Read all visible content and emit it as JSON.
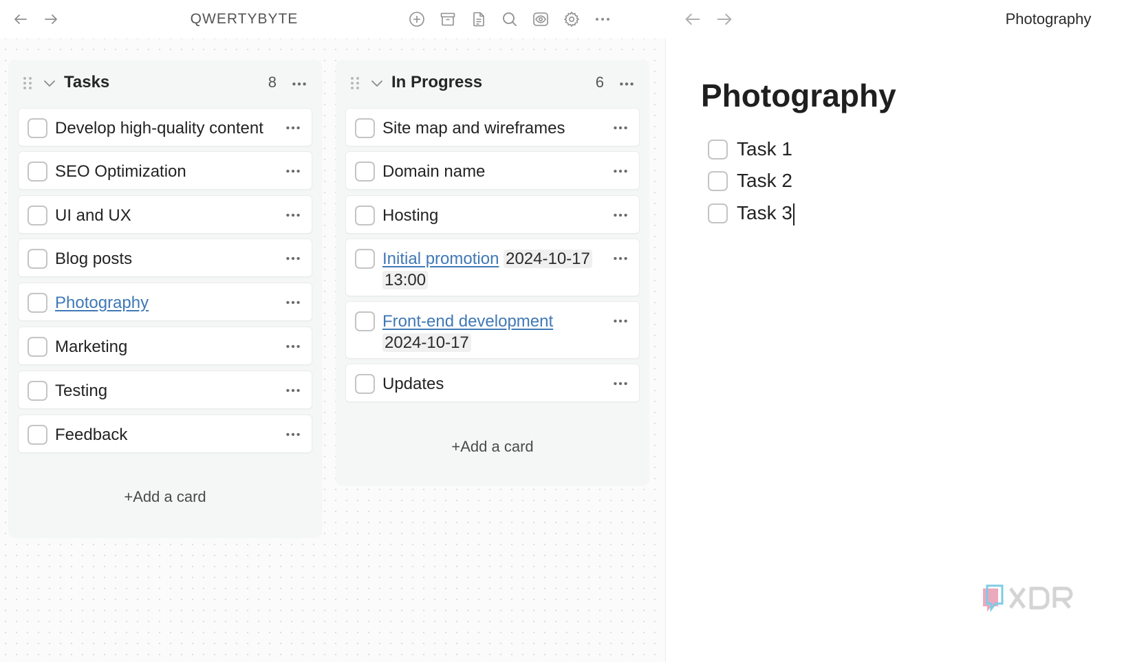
{
  "toolbar": {
    "app_title": "QWERTYBYTE",
    "icons": [
      "back-arrow-icon",
      "forward-arrow-icon",
      "add-circle-icon",
      "archive-icon",
      "document-icon",
      "search-icon",
      "eye-icon",
      "gear-icon",
      "more-horizontal-icon"
    ]
  },
  "board": {
    "columns": [
      {
        "title": "Tasks",
        "count": "8",
        "add_label": "+Add a card",
        "cards": [
          {
            "label": "Develop high-quality content"
          },
          {
            "label": "SEO Optimization"
          },
          {
            "label": "UI and UX"
          },
          {
            "label": "Blog posts"
          },
          {
            "label": "Photography",
            "link": true
          },
          {
            "label": "Marketing"
          },
          {
            "label": "Testing"
          },
          {
            "label": "Feedback"
          }
        ]
      },
      {
        "title": "In Progress",
        "count": "6",
        "add_label": "+Add a card",
        "cards": [
          {
            "label": "Site map and wireframes"
          },
          {
            "label": "Domain name"
          },
          {
            "label": "Hosting"
          },
          {
            "label": "Initial promotion",
            "link": true,
            "date": "2024-10-17",
            "time": "13:00"
          },
          {
            "label": "Front-end development",
            "link": true,
            "date": "2024-10-17"
          },
          {
            "label": "Updates"
          }
        ]
      }
    ]
  },
  "document": {
    "breadcrumb": "Photography",
    "title": "Photography",
    "todos": [
      {
        "label": "Task 1",
        "checked": false
      },
      {
        "label": "Task 2",
        "checked": false
      },
      {
        "label": "Task 3",
        "checked": false
      }
    ]
  },
  "colors": {
    "link": "#3f78b6",
    "column_bg": "#f5f6f6",
    "checkbox_border": "#c4c4c4",
    "watermark_pink": "#e8a0b5",
    "watermark_blue": "#7ecbe6"
  }
}
